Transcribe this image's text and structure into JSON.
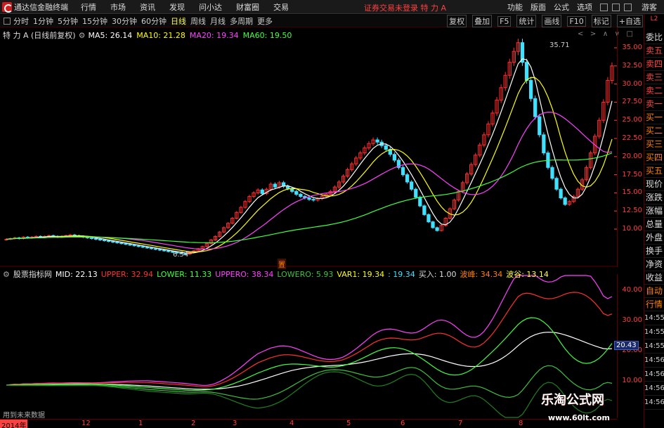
{
  "menubar": {
    "app_title": "通达信金融终端",
    "items": [
      "行情",
      "市场",
      "资讯",
      "发现",
      "问小达",
      "财富圈",
      "交易"
    ],
    "login_notice": "证券交易未登录 特 力 A",
    "right_items": [
      "功能",
      "版面",
      "公式",
      "选项"
    ],
    "guest": "游客"
  },
  "periodbar": {
    "periods": [
      "分时",
      "1分钟",
      "5分钟",
      "15分钟",
      "30分钟",
      "60分钟",
      "日线",
      "周线",
      "月线",
      "多周期",
      "更多"
    ],
    "active": "日线",
    "right_tools": [
      "复权",
      "叠加",
      "F5",
      "统计",
      "画线",
      "F10",
      "标记",
      "+自选"
    ]
  },
  "main_chart": {
    "title": "特 力 A (日线前复权)",
    "ma5": "MA5: 26.14",
    "ma10": "MA10: 21.28",
    "ma20": "MA20: 19.34",
    "ma60": "MA60: 19.50",
    "max_label": "35.71",
    "min_label": "6.54",
    "tag": "置",
    "price_axis": [
      "35.00",
      "32.50",
      "30.00",
      "27.50",
      "25.00",
      "22.50",
      "20.00",
      "17.50",
      "15.00",
      "12.50",
      "10.00"
    ],
    "colors": {
      "up": "#ff3030",
      "down": "#40e0ff",
      "ma5": "#ffffff",
      "ma10": "#ffff00",
      "ma20": "#ff40ff",
      "ma60": "#40ff40"
    }
  },
  "indicator": {
    "name": "股票指标网",
    "mid": "MID: 22.13",
    "upper": "UPPER: 32.94",
    "lower": "LOWER: 11.33",
    "uppero": "UPPERO: 38.34",
    "lowero": "LOWERO: 5.93",
    "var1": "VAR1: 19.34",
    "var1b": ": 19.34",
    "buy": "买入: 1.00",
    "peak": "波峰: 34.34",
    "valley": "波谷: 13.14",
    "axis": [
      "40.00",
      "30.00",
      "20.00",
      "10.00"
    ],
    "current_value": "20.43",
    "future_label": "用到未来数据"
  },
  "sidebar": {
    "top": "L2",
    "items": [
      "委比",
      "卖五",
      "卖四",
      "卖三",
      "卖二",
      "卖一",
      "买一",
      "买二",
      "买三",
      "买四",
      "买五",
      "现价",
      "涨跌",
      "涨幅",
      "总量",
      "外盘",
      "换手",
      "净资",
      "收益"
    ],
    "bottom_items": [
      "自动",
      "行情"
    ],
    "times": [
      "14:55",
      "14:55",
      "14:55",
      "14:56",
      "14:56",
      "14:56",
      "14:56"
    ]
  },
  "date_axis": {
    "year": "2014年",
    "labels": [
      "12",
      "1",
      "2",
      "3",
      "4",
      "5",
      "6",
      "7",
      "8"
    ]
  },
  "watermark": {
    "text": "乐淘公式网",
    "url": "www.60lt.com"
  },
  "chart_data": {
    "type": "candlestick",
    "title": "特 力 A (日线前复权)",
    "ylim": [
      7.5,
      36.5
    ],
    "y_ticks": [
      10.0,
      12.5,
      15.0,
      17.5,
      20.0,
      22.5,
      25.0,
      27.5,
      30.0,
      32.5,
      35.0
    ],
    "x_labels": [
      "12",
      "1",
      "2",
      "3",
      "4",
      "5",
      "6",
      "7",
      "8"
    ],
    "close": [
      8.6,
      8.7,
      8.8,
      8.7,
      8.9,
      8.8,
      8.9,
      9.0,
      8.9,
      9.0,
      9.1,
      9.0,
      8.9,
      9.0,
      9.1,
      9.2,
      9.1,
      9.0,
      8.9,
      8.8,
      8.7,
      8.6,
      8.5,
      8.4,
      8.3,
      8.2,
      8.1,
      8.0,
      7.9,
      7.8,
      7.7,
      7.6,
      7.5,
      7.4,
      7.3,
      7.2,
      7.1,
      7.0,
      6.9,
      6.8,
      6.7,
      6.6,
      6.54,
      6.8,
      7.0,
      7.3,
      7.6,
      8.0,
      8.5,
      9.0,
      9.6,
      10.2,
      10.8,
      11.5,
      12.3,
      13.0,
      13.8,
      14.5,
      15.0,
      15.4,
      14.9,
      15.5,
      16.2,
      15.8,
      16.4,
      15.9,
      15.6,
      15.2,
      14.8,
      14.5,
      14.3,
      14.1,
      14.0,
      14.2,
      14.5,
      14.8,
      15.2,
      15.8,
      16.5,
      17.3,
      18.2,
      19.0,
      19.8,
      20.5,
      21.2,
      21.8,
      22.3,
      22.0,
      21.5,
      21.0,
      20.3,
      19.5,
      18.5,
      17.5,
      16.5,
      15.5,
      14.4,
      13.2,
      12.0,
      11.0,
      10.2,
      9.8,
      10.5,
      11.5,
      12.8,
      14.0,
      15.2,
      16.4,
      17.6,
      18.9,
      20.2,
      21.6,
      23.0,
      24.5,
      26.0,
      27.8,
      29.5,
      31.2,
      33.0,
      34.5,
      35.71,
      33.0,
      30.5,
      28.0,
      25.5,
      23.0,
      20.5,
      18.5,
      17.0,
      15.5,
      14.3,
      13.4,
      13.8,
      14.5,
      15.5,
      16.8,
      18.5,
      20.5,
      22.8,
      25.0,
      27.5,
      30.5,
      32.5
    ]
  }
}
